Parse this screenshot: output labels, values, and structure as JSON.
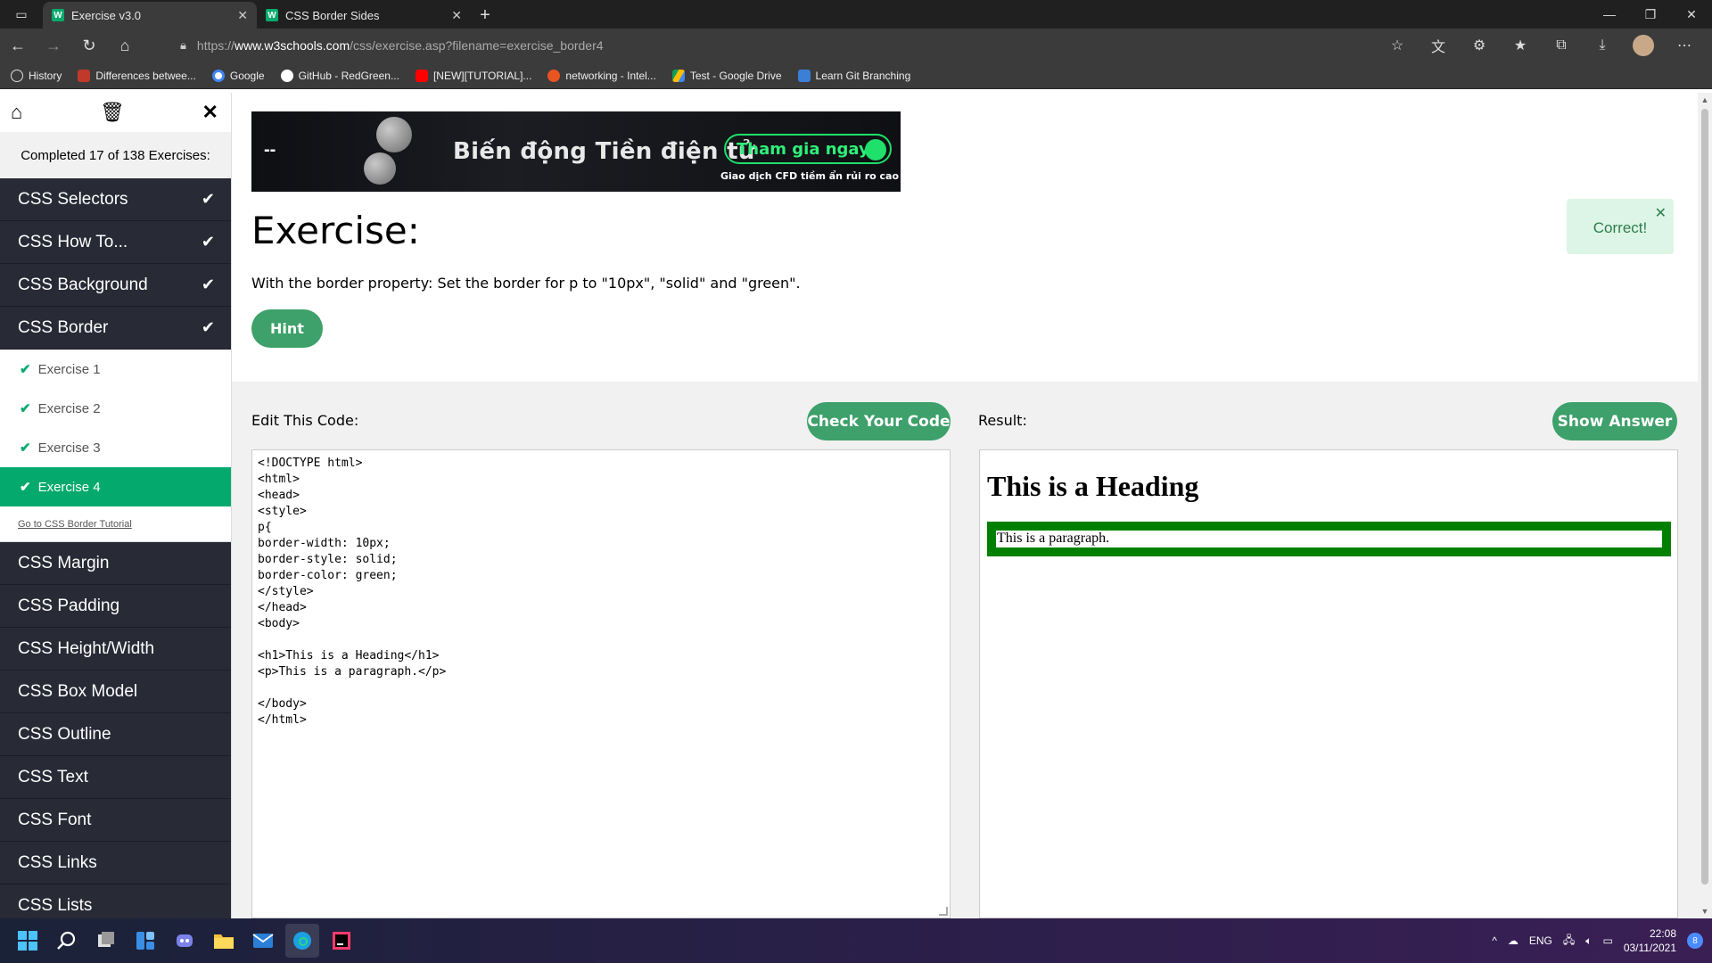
{
  "browser": {
    "tabs": [
      {
        "title": "Exercise v3.0",
        "favicon": "W",
        "active": true
      },
      {
        "title": "CSS Border Sides",
        "favicon": "W",
        "active": false
      }
    ],
    "url_scheme": "https://",
    "url_host": "www.w3schools.com",
    "url_path": "/css/exercise.asp?filename=exercise_border4",
    "bookmarks": [
      {
        "label": "History",
        "icon": "history-icon",
        "color": "#dddddd"
      },
      {
        "label": "Differences betwee...",
        "icon": "site-icon",
        "color": "#c0392b"
      },
      {
        "label": "Google",
        "icon": "google-icon",
        "color": "#4285f4"
      },
      {
        "label": "GitHub - RedGreen...",
        "icon": "github-icon",
        "color": "#ffffff"
      },
      {
        "label": "[NEW][TUTORIAL]...",
        "icon": "youtube-icon",
        "color": "#ff0000"
      },
      {
        "label": "networking - Intel...",
        "icon": "askubuntu-icon",
        "color": "#e95420"
      },
      {
        "label": "Test - Google Drive",
        "icon": "drive-icon",
        "color": "#fbbc04"
      },
      {
        "label": "Learn Git Branching",
        "icon": "git-icon",
        "color": "#3b7fd6"
      }
    ]
  },
  "sidebar": {
    "status": "Completed 17 of 138 Exercises:",
    "sections_before": [
      {
        "label": "CSS Selectors",
        "done": true
      },
      {
        "label": "CSS How To...",
        "done": true
      },
      {
        "label": "CSS Background",
        "done": true
      },
      {
        "label": "CSS Border",
        "done": true
      }
    ],
    "exercises": [
      {
        "label": "Exercise 1",
        "active": false
      },
      {
        "label": "Exercise 2",
        "active": false
      },
      {
        "label": "Exercise 3",
        "active": false
      },
      {
        "label": "Exercise 4",
        "active": true
      }
    ],
    "tutorial_link": "Go to CSS Border Tutorial",
    "sections_after": [
      {
        "label": "CSS Margin"
      },
      {
        "label": "CSS Padding"
      },
      {
        "label": "CSS Height/Width"
      },
      {
        "label": "CSS Box Model"
      },
      {
        "label": "CSS Outline"
      },
      {
        "label": "CSS Text"
      },
      {
        "label": "CSS Font"
      },
      {
        "label": "CSS Links"
      },
      {
        "label": "CSS Lists"
      }
    ]
  },
  "ad": {
    "dash": "--",
    "title": "Biến động Tiền điện tử",
    "cta": "Tham gia ngay",
    "subtitle": "Giao dịch CFD tiềm ẩn rủi ro cao",
    "accent": "#1ee06a"
  },
  "exercise": {
    "heading": "Exercise:",
    "description": "With the border property: Set the border for p to \"10px\", \"solid\" and \"green\".",
    "hint_label": "Hint",
    "toast": "Correct!",
    "edit_label": "Edit This Code:",
    "check_label": "Check Your Code",
    "result_label": "Result:",
    "answer_label": "Show Answer",
    "code_lines": [
      "<!DOCTYPE html>",
      "<html>",
      "<head>",
      "<style>",
      "p{",
      "border-width: 10px;",
      "border-style: solid;",
      "border-color: green;",
      "</style>",
      "</head>",
      "<body>",
      "",
      "<h1>This is a Heading</h1>",
      "<p>This is a paragraph.</p>",
      "",
      "</body>",
      "</html>"
    ],
    "result_heading": "This is a Heading",
    "result_paragraph": "This is a paragraph.",
    "accent": "#3ea06a"
  },
  "taskbar": {
    "language": "ENG",
    "time": "22:08",
    "date": "03/11/2021",
    "notifications": "8"
  }
}
